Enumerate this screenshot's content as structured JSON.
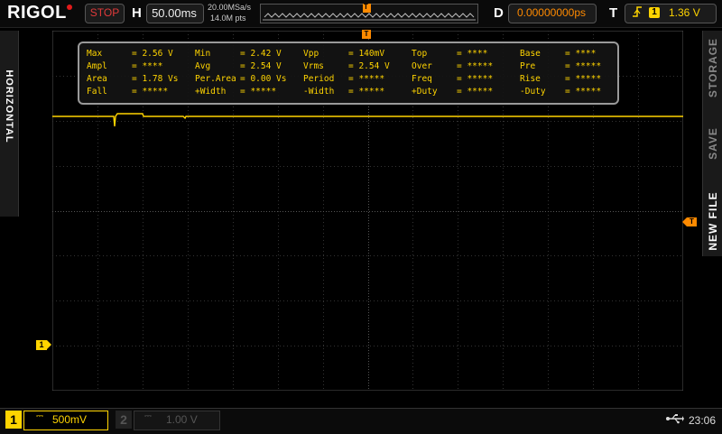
{
  "header": {
    "brand": "RIGOL",
    "run_status": "STOP",
    "horizontal_letter": "H",
    "timebase": "50.00ms",
    "sample_rate": "20.00MSa/s",
    "memory_depth": "14.0M pts",
    "delay_letter": "D",
    "delay_value": "0.00000000ps",
    "trigger_letter": "T",
    "trigger_source": "1",
    "trigger_level": "1.36 V",
    "trigger_marker": "T"
  },
  "side_tabs": {
    "left": "HORIZONTAL",
    "right": [
      "STORAGE",
      "SAVE",
      "NEW FILE"
    ]
  },
  "measurements": [
    [
      {
        "label": "Max",
        "value": "= 2.56 V"
      },
      {
        "label": "Min",
        "value": "= 2.42 V"
      },
      {
        "label": "Vpp",
        "value": "= 140mV"
      },
      {
        "label": "Top",
        "value": "= ****"
      },
      {
        "label": "Base",
        "value": "= ****"
      }
    ],
    [
      {
        "label": "Ampl",
        "value": "= ****"
      },
      {
        "label": "Avg",
        "value": "= 2.54 V"
      },
      {
        "label": "Vrms",
        "value": "= 2.54 V"
      },
      {
        "label": "Over",
        "value": "= *****"
      },
      {
        "label": "Pre",
        "value": "= *****"
      }
    ],
    [
      {
        "label": "Area",
        "value": "= 1.78 Vs"
      },
      {
        "label": "Per.Area",
        "value": "= 0.00 Vs"
      },
      {
        "label": "Period",
        "value": "= *****"
      },
      {
        "label": "Freq",
        "value": "= *****"
      },
      {
        "label": "Rise",
        "value": "= *****"
      }
    ],
    [
      {
        "label": "Fall",
        "value": "= *****"
      },
      {
        "label": "+Width",
        "value": "= *****"
      },
      {
        "label": "-Width",
        "value": "= *****"
      },
      {
        "label": "+Duty",
        "value": "= *****"
      },
      {
        "label": "-Duty",
        "value": "= *****"
      }
    ]
  ],
  "channels": {
    "ch1": {
      "number": "1",
      "coupling": "⎓",
      "scale": "500mV",
      "color": "#ffd400",
      "marker": "1"
    },
    "ch2": {
      "number": "2",
      "coupling": "⎓",
      "scale": "1.00 V",
      "color": "#555555"
    }
  },
  "status": {
    "usb_icon": "usb-icon",
    "time": "23:06"
  },
  "colors": {
    "channel1": "#ffd400",
    "trigger": "#ff8a00",
    "run_stop": "#e03a3a"
  }
}
